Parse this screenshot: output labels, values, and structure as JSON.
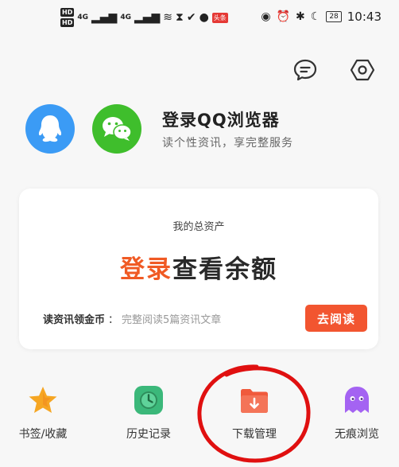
{
  "status_bar": {
    "hd_top": "HD",
    "hd_bottom": "HD",
    "signal1": "4G",
    "signal2": "4G",
    "battery": "28",
    "time": "10:43",
    "badge": "头条",
    "icons_left": [
      "wifi-icon",
      "hourglass-icon",
      "check-icon",
      "chat-bubble-icon"
    ],
    "icons_right": [
      "eye-icon",
      "alarm-icon",
      "bluetooth-icon",
      "moon-icon",
      "battery-icon"
    ]
  },
  "header": {
    "icons": [
      "message-icon",
      "settings-hexagon-icon"
    ]
  },
  "login": {
    "title": "登录QQ浏览器",
    "subtitle": "读个性资讯，享完整服务",
    "icons": [
      "qq-penguin-icon",
      "wechat-icon"
    ],
    "colors": {
      "qq": "#3b9bf5",
      "wechat": "#3fbe2c"
    }
  },
  "assets_card": {
    "caption": "我的总资产",
    "headline_login": "登录",
    "headline_rest": "查看余额",
    "coin_label": "读资讯领金币",
    "coin_sep": "：",
    "coin_desc": "完整阅读5篇资讯文章",
    "read_button": "去阅读",
    "accent_color": "#f25530"
  },
  "quick_nav": [
    {
      "label": "书签/收藏",
      "icon": "star-icon"
    },
    {
      "label": "历史记录",
      "icon": "clock-icon"
    },
    {
      "label": "下载管理",
      "icon": "download-folder-icon"
    },
    {
      "label": "无痕浏览",
      "icon": "ghost-icon"
    }
  ]
}
